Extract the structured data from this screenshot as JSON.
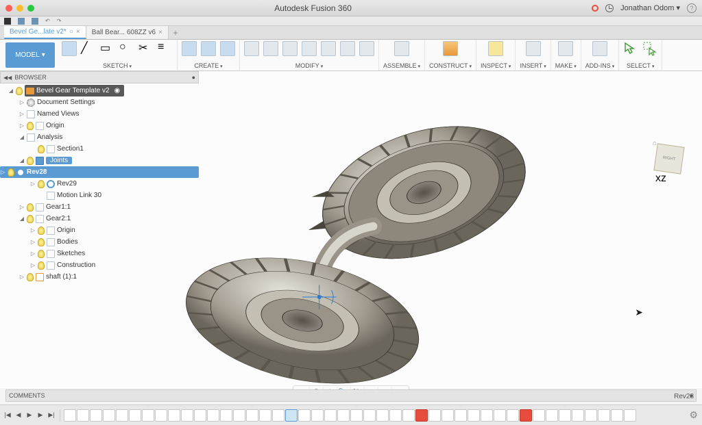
{
  "app": {
    "title": "Autodesk Fusion 360",
    "user": "Jonathan Odom"
  },
  "tabs": [
    {
      "label": "Bevel Ge...late v2*",
      "active": true
    },
    {
      "label": "Ball Bear... 608ZZ v6",
      "active": false
    }
  ],
  "model_button": "MODEL",
  "toolbar_groups": {
    "sketch": "SKETCH",
    "create": "CREATE",
    "modify": "MODIFY",
    "assemble": "ASSEMBLE",
    "construct": "CONSTRUCT",
    "inspect": "INSPECT",
    "insert": "INSERT",
    "make": "MAKE",
    "addins": "ADD-INS",
    "select": "SELECT"
  },
  "browser": {
    "header": "BROWSER",
    "root": "Bevel Gear Template v2",
    "items": {
      "doc_settings": "Document Settings",
      "named_views": "Named Views",
      "origin": "Origin",
      "analysis": "Analysis",
      "section1": "Section1",
      "joints": "Joints",
      "rev28": "Rev28",
      "rev29": "Rev29",
      "motion_link": "Motion Link 30",
      "gear1": "Gear1:1",
      "gear2": "Gear2:1",
      "g2_origin": "Origin",
      "g2_bodies": "Bodies",
      "g2_sketches": "Sketches",
      "g2_construction": "Construction",
      "shaft": "shaft (1):1"
    }
  },
  "comments": {
    "header": "COMMENTS"
  },
  "status": {
    "selection": "Rev28"
  },
  "viewcube": {
    "face": "RIGHT"
  }
}
